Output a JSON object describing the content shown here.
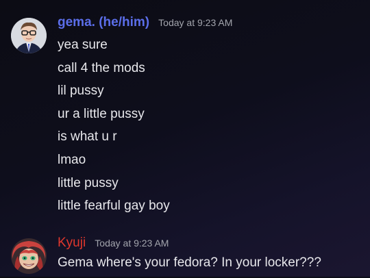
{
  "messages": [
    {
      "author": "gema. (he/him)",
      "timestamp": "Today at 9:23 AM",
      "author_color": "#5b6ee9",
      "avatar_icon": "avatar-icon",
      "lines": [
        "yea sure",
        "call 4 the mods",
        "lil pussy",
        "ur a little pussy",
        "is what u r",
        "lmao",
        "little pussy",
        "little fearful gay boy"
      ]
    },
    {
      "author": "Kyuji",
      "timestamp": "Today at 9:23 AM",
      "author_color": "#e0372d",
      "avatar_icon": "avatar-icon",
      "lines": [
        "Gema where's your fedora? In your locker???"
      ]
    }
  ]
}
